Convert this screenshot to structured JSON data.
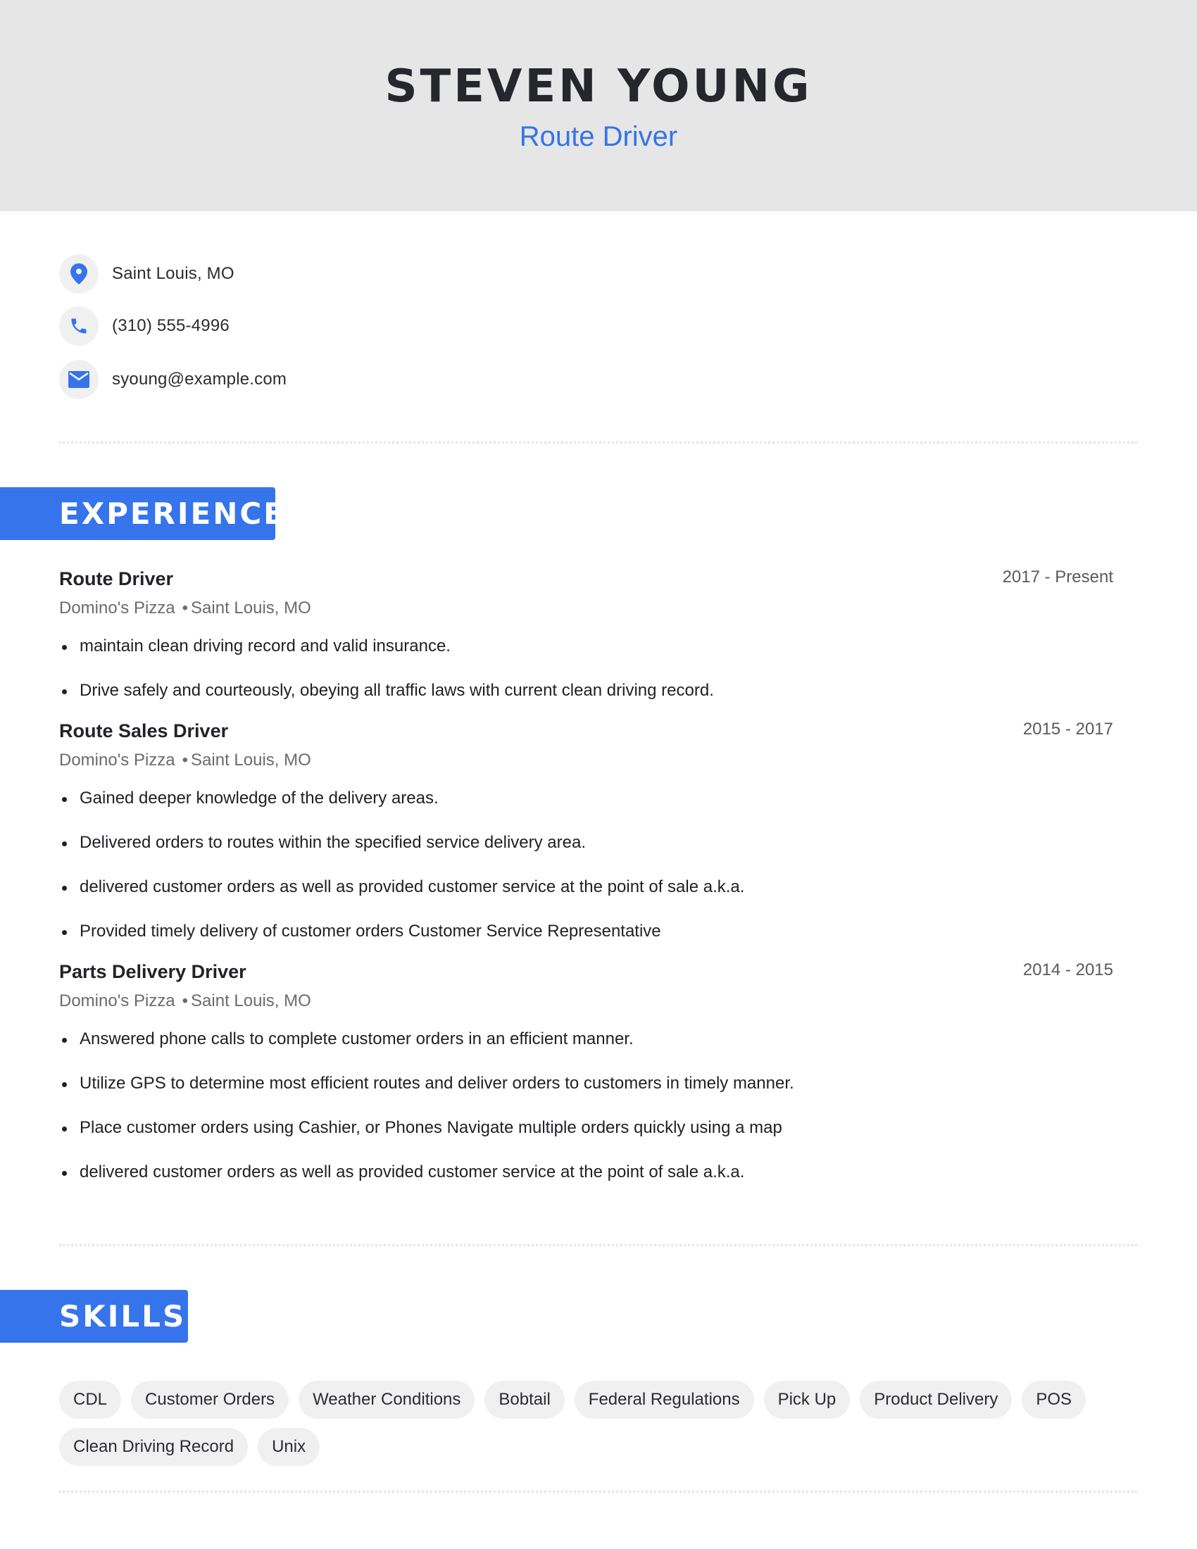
{
  "header": {
    "name": "STEVEN YOUNG",
    "title": "Route Driver"
  },
  "contact": {
    "location": {
      "icon": "map-pin-icon",
      "text": "Saint Louis, MO"
    },
    "phone": {
      "icon": "phone-icon",
      "text": "(310) 555-4996"
    },
    "email": {
      "icon": "envelope-icon",
      "text": "syoung@example.com"
    }
  },
  "colors": {
    "accent": "#3574ea",
    "header_bg": "#e6e6e6",
    "chip_bg": "#f0f0f1"
  },
  "experience": {
    "heading": "EXPERIENCE",
    "jobs": [
      {
        "title": "Route Driver",
        "dates": "2017 - Present",
        "company": "Domino's Pizza",
        "separator": "•",
        "location": "Saint Louis, MO",
        "bullets": [
          "maintain clean driving record and valid insurance.",
          "Drive safely and courteously, obeying all traffic laws with current clean driving record."
        ]
      },
      {
        "title": "Route Sales Driver",
        "dates": "2015 - 2017",
        "company": "Domino's Pizza",
        "separator": "•",
        "location": "Saint Louis, MO",
        "bullets": [
          "Gained deeper knowledge of the delivery areas.",
          "Delivered orders to routes within the specified service delivery area.",
          "delivered customer orders as well as provided customer service at the point of sale a.k.a.",
          "Provided timely delivery of customer orders Customer Service Representative"
        ]
      },
      {
        "title": "Parts Delivery Driver",
        "dates": "2014 - 2015",
        "company": "Domino's Pizza",
        "separator": "•",
        "location": "Saint Louis, MO",
        "bullets": [
          "Answered phone calls to complete customer orders in an efficient manner.",
          "Utilize GPS to determine most efficient routes and deliver orders to customers in timely manner.",
          "Place customer orders using Cashier, or Phones Navigate multiple orders quickly using a map",
          "delivered customer orders as well as provided customer service at the point of sale a.k.a."
        ]
      }
    ]
  },
  "skills": {
    "heading": "SKILLS",
    "items": [
      "CDL",
      "Customer Orders",
      "Weather Conditions",
      "Bobtail",
      "Federal Regulations",
      "Pick Up",
      "Product Delivery",
      "POS",
      "Clean Driving Record",
      "Unix"
    ]
  }
}
